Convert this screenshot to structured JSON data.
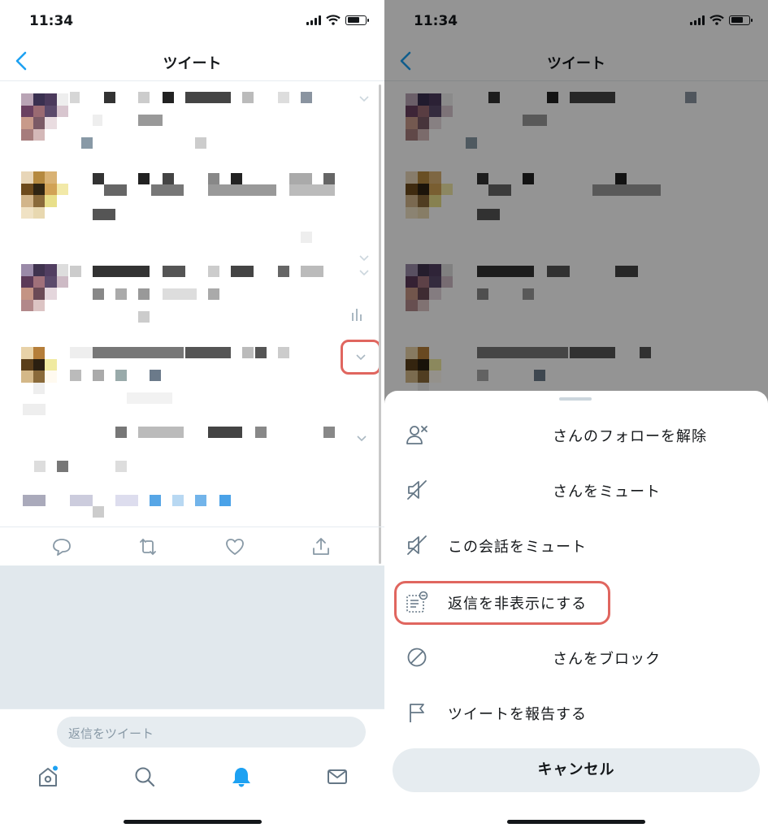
{
  "status_bar": {
    "time": "11:34"
  },
  "header": {
    "title": "ツイート"
  },
  "reply": {
    "placeholder": "返信をツイート"
  },
  "menu": {
    "items": [
      {
        "icon": "unfollow-icon",
        "label": "さんのフォローを解除"
      },
      {
        "icon": "mute-icon",
        "label": "さんをミュート"
      },
      {
        "icon": "mute-conversation-icon",
        "label": "この会話をミュート"
      },
      {
        "icon": "hide-reply-icon",
        "label": "返信を非表示にする"
      },
      {
        "icon": "block-icon",
        "label": "さんをブロック"
      },
      {
        "icon": "report-icon",
        "label": "ツイートを報告する"
      }
    ],
    "cancel": "キャンセル"
  },
  "colors": {
    "accent": "#1da1f2",
    "highlight": "#e0665f",
    "divider": "#e6ecf0",
    "grey_area": "#e1e8ed"
  }
}
